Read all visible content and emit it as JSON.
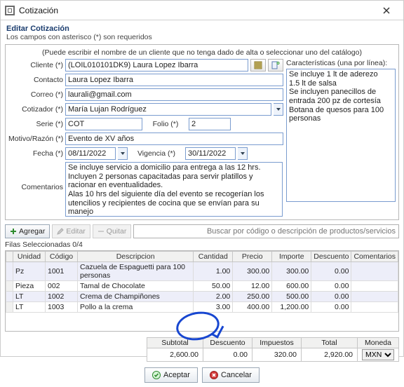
{
  "window": {
    "title": "Cotización"
  },
  "header": {
    "title": "Editar Cotización",
    "subtitle": "Los campos con asterisco (*) son requeridos"
  },
  "hint": "(Puede escribir el nombre de un cliente que no tenga dado de alta o seleccionar uno del catálogo)",
  "labels": {
    "cliente": "Cliente (*)",
    "contacto": "Contacto",
    "correo": "Correo (*)",
    "cotizador": "Cotizador (*)",
    "serie": "Serie (*)",
    "folio": "Folio (*)",
    "motivo": "Motivo/Razón (*)",
    "fecha": "Fecha (*)",
    "vigencia": "Vigencia (*)",
    "comentarios": "Comentarios",
    "caracteristicas": "Características (una por línea):"
  },
  "form": {
    "cliente": "(LOIL010101DK9) Laura Lopez Ibarra",
    "contacto": "Laura Lopez Ibarra",
    "correo": "laurali@gmail.com",
    "cotizador": "María Lujan Rodríguez",
    "serie": "COT",
    "folio": "2",
    "motivo": "Evento de XV años",
    "fecha": "08/11/2022",
    "vigencia": "30/11/2022",
    "comentarios": "Se incluye servicio a domicilio para entrega a las 12 hrs.\nIncluyen 2 personas capacitadas para servir platillos y racionar en eventualidades.\nAlas 10 hrs del siguiente día del evento se recogerían los utencilios y recipientes de cocina que se envían para su manejo\nNo se incluye losa para servir platillos.",
    "caracteristicas": "Se incluye 1 lt de aderezo\n1.5 lt de salsa\nSe incluyen panecillos de entrada 200 pz de cortesía\nBotana de quesos para 100 personas"
  },
  "toolbar": {
    "agregar": "Agregar",
    "editar": "Editar",
    "quitar": "Quitar",
    "search_placeholder": "Buscar por código o descripción de productos/servicios"
  },
  "grid": {
    "selected": "Filas Seleccionadas  0/4",
    "headers": {
      "unidad": "Unidad",
      "codigo": "Código",
      "descripcion": "Descripcion",
      "cantidad": "Cantidad",
      "precio": "Precio",
      "importe": "Importe",
      "descuento": "Descuento",
      "comentarios": "Comentarios"
    },
    "rows": [
      {
        "unidad": "Pz",
        "codigo": "1001",
        "descripcion": "Cazuela de Espaguetti para 100 personas",
        "cantidad": "1.00",
        "precio": "300.00",
        "importe": "300.00",
        "descuento": "0.00"
      },
      {
        "unidad": "Pieza",
        "codigo": "002",
        "descripcion": "Tamal de Chocolate",
        "cantidad": "50.00",
        "precio": "12.00",
        "importe": "600.00",
        "descuento": "0.00"
      },
      {
        "unidad": "LT",
        "codigo": "1002",
        "descripcion": "Crema de Champiñones",
        "cantidad": "2.00",
        "precio": "250.00",
        "importe": "500.00",
        "descuento": "0.00"
      },
      {
        "unidad": "LT",
        "codigo": "1003",
        "descripcion": "Pollo a la crema",
        "cantidad": "3.00",
        "precio": "400.00",
        "importe": "1,200.00",
        "descuento": "0.00"
      }
    ]
  },
  "totals": {
    "headers": {
      "subtotal": "Subtotal",
      "descuento": "Descuento",
      "impuestos": "Impuestos",
      "total": "Total",
      "moneda": "Moneda"
    },
    "values": {
      "subtotal": "2,600.00",
      "descuento": "0.00",
      "impuestos": "320.00",
      "total": "2,920.00",
      "moneda": "MXN"
    }
  },
  "actions": {
    "aceptar": "Aceptar",
    "cancelar": "Cancelar"
  }
}
